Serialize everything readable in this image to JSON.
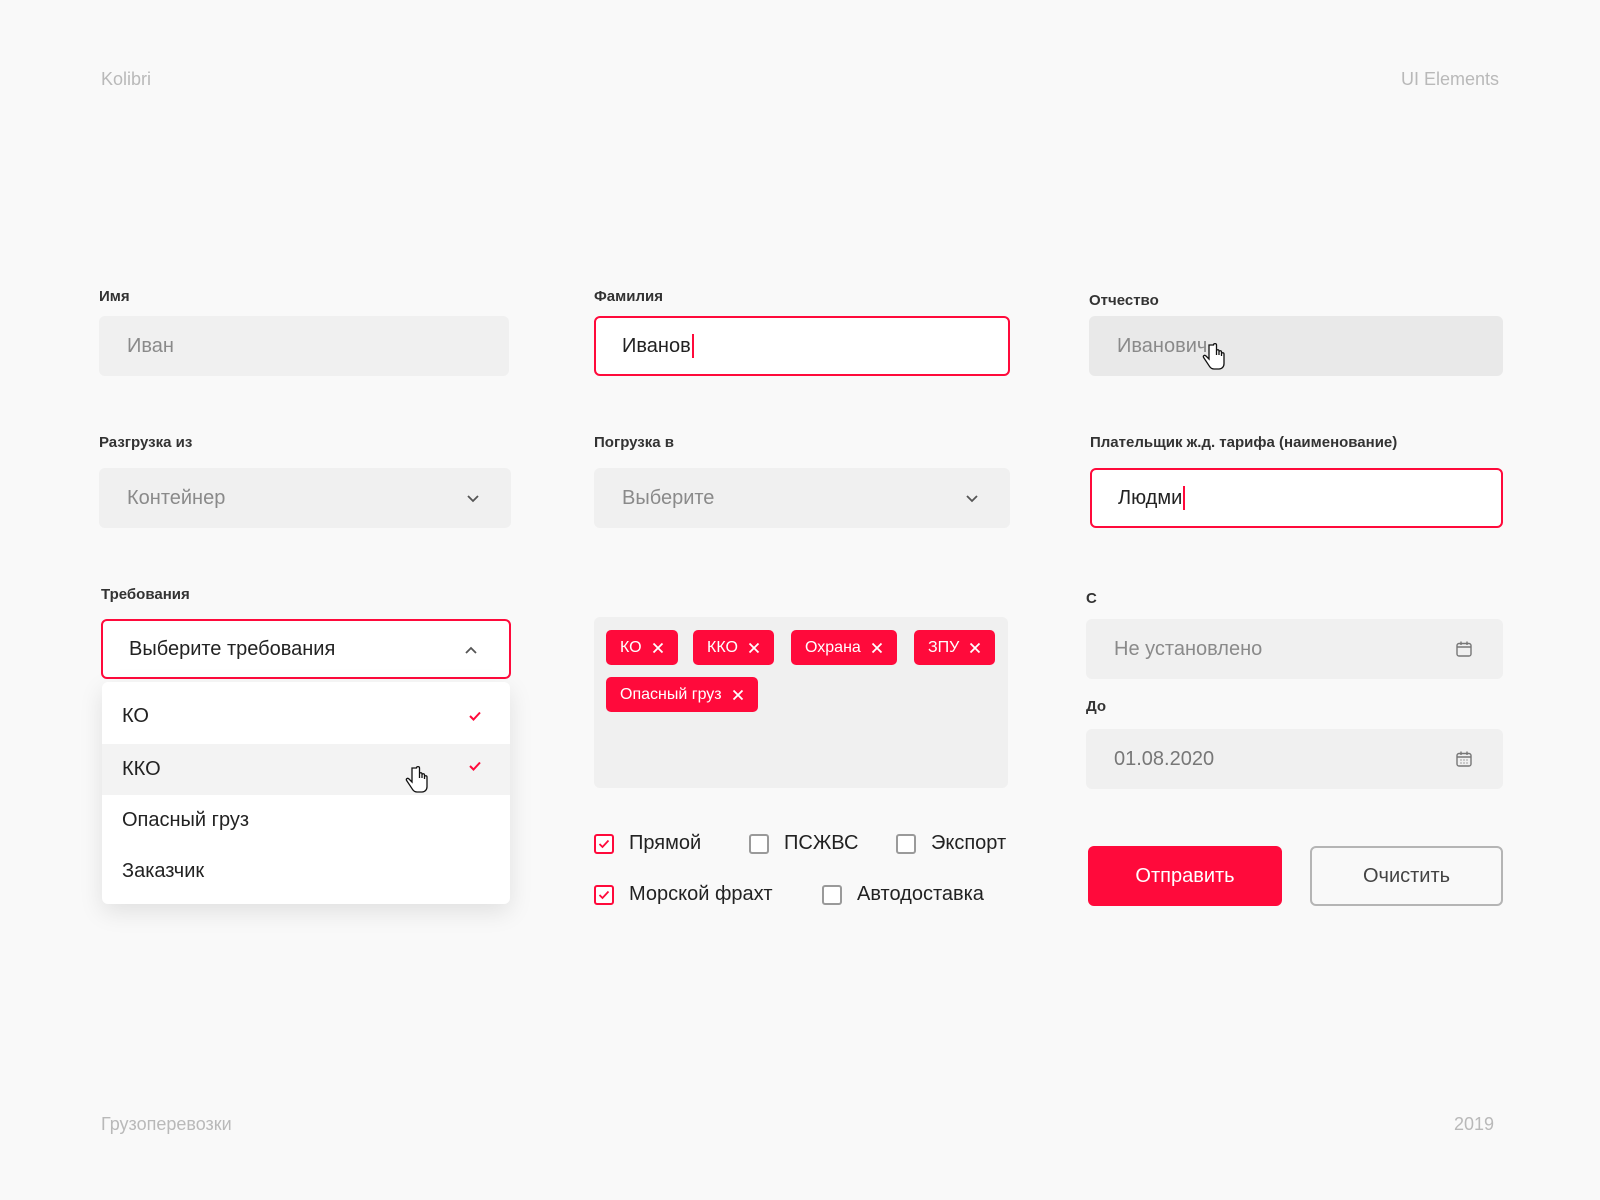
{
  "header": {
    "brand": "Kolibri",
    "section": "UI Elements"
  },
  "footer": {
    "left": "Грузоперевозки",
    "right": "2019"
  },
  "form": {
    "first_name": {
      "label": "Имя",
      "value": "Иван"
    },
    "last_name": {
      "label": "Фамилия",
      "value": "Иванов"
    },
    "patronymic": {
      "label": "Отчество",
      "value": "Иванович"
    },
    "unload_from": {
      "label": "Разгрузка из",
      "value": "Контейнер"
    },
    "load_to": {
      "label": "Погрузка в",
      "placeholder": "Выберите"
    },
    "payer": {
      "label": "Плательщик ж.д. тарифа (наименование)",
      "value": "Людми"
    },
    "requirements": {
      "label": "Требования",
      "placeholder": "Выберите требования",
      "options": [
        {
          "label": "КО",
          "checked": true
        },
        {
          "label": "ККО",
          "checked": true
        },
        {
          "label": "Опасный груз",
          "checked": false
        },
        {
          "label": "Заказчик",
          "checked": false
        }
      ]
    },
    "tags": [
      "КО",
      "ККО",
      "Охрана",
      "ЗПУ",
      "Опасный груз"
    ],
    "date_from": {
      "label": "С",
      "placeholder": "Не установлено"
    },
    "date_to": {
      "label": "До",
      "value": "01.08.2020"
    },
    "checkboxes": [
      {
        "label": "Прямой",
        "checked": true
      },
      {
        "label": "ПСЖВС",
        "checked": false
      },
      {
        "label": "Экспорт",
        "checked": false
      },
      {
        "label": "Морской фрахт",
        "checked": true
      },
      {
        "label": "Автодоставка",
        "checked": false
      }
    ],
    "submit_label": "Отправить",
    "clear_label": "Очистить"
  },
  "colors": {
    "accent": "#ff0a3b",
    "field_bg": "#f0f0f0",
    "page_bg": "#f9f9f9"
  }
}
